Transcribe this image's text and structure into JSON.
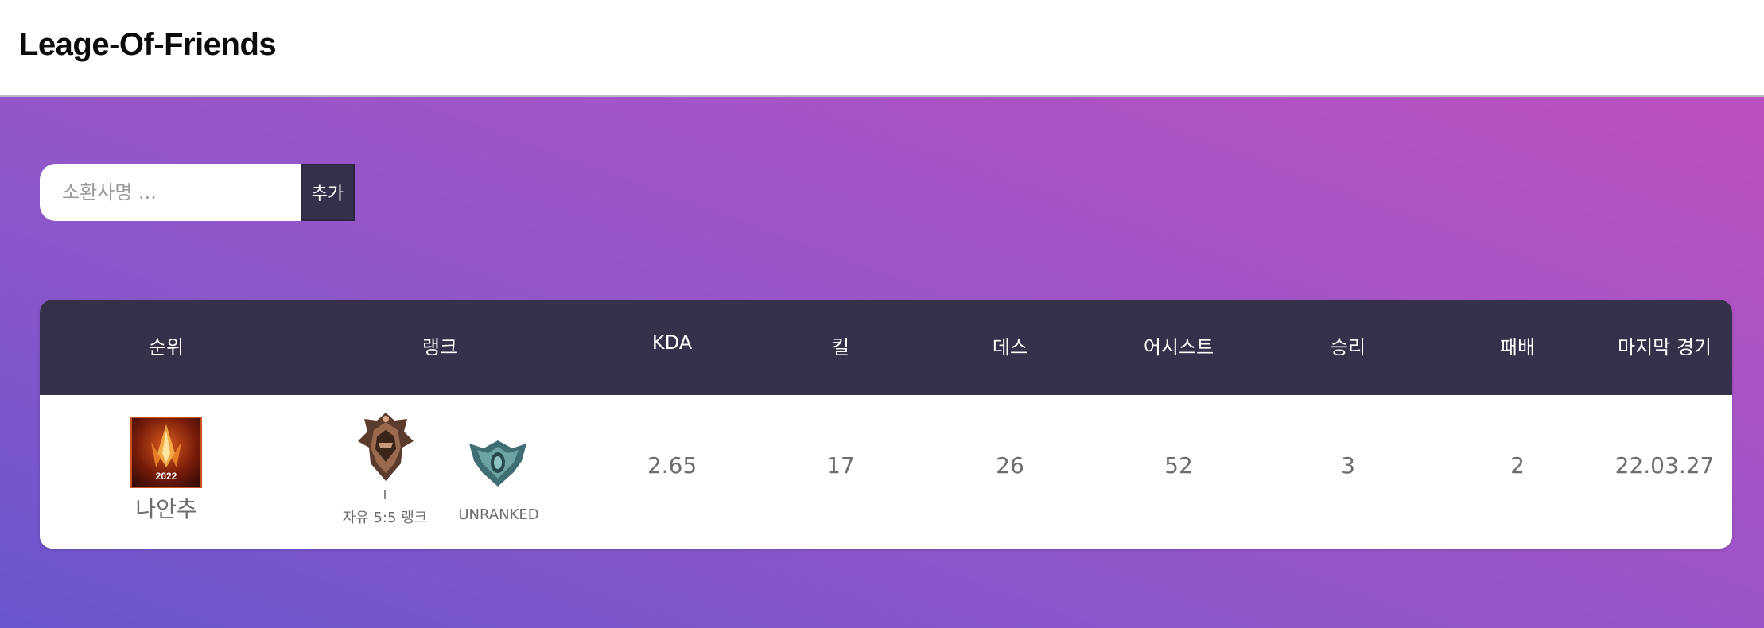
{
  "app": {
    "title": "Leage-Of-Friends"
  },
  "search": {
    "placeholder": "소환사명 ...",
    "value": "",
    "add_label": "추가"
  },
  "table": {
    "headers": {
      "rank_position": "순위",
      "rank": "랭크",
      "kda": "KDA",
      "kills": "킬",
      "deaths": "데스",
      "assists": "어시스트",
      "wins": "승리",
      "losses": "패배",
      "last_game": "마지막 경기"
    },
    "rows": [
      {
        "profile_icon": "profile-2022-icon",
        "profile_icon_text": "2022",
        "summoner_name": "나안추",
        "flex_rank": {
          "emblem": "bronze-emblem-icon",
          "tier": "I",
          "queue": "자유 5:5 랭크"
        },
        "solo_rank": {
          "emblem": "unranked-emblem-icon",
          "label": "UNRANKED"
        },
        "kda": "2.65",
        "kills": "17",
        "deaths": "26",
        "assists": "52",
        "wins": "3",
        "losses": "2",
        "last_game": "22.03.27"
      }
    ]
  },
  "colors": {
    "header_bg": "#ffffff",
    "table_header_bg": "#37304a",
    "gradient_start": "#6a55cf",
    "gradient_end": "#c44fbf",
    "cell_text": "#6d6d6d"
  }
}
